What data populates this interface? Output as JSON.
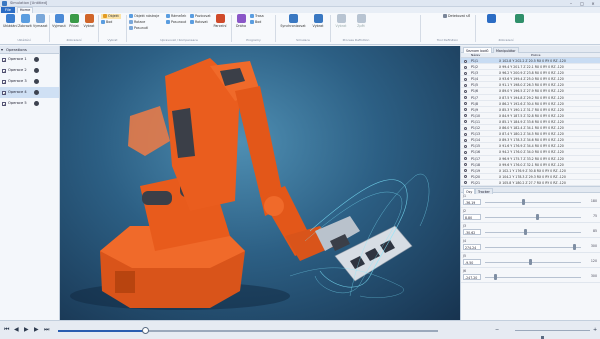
{
  "titlebar": {
    "title": "Simulation [Untitled]"
  },
  "tabs": {
    "file": "File",
    "home": "Home"
  },
  "ribbon": {
    "buttons": [
      {
        "label": "Ukládání"
      },
      {
        "label": "Zobrazit"
      },
      {
        "label": "Vymazat"
      },
      {
        "label": "Vyjmout"
      },
      {
        "label": "Přidat"
      },
      {
        "label": "Vybrat"
      },
      {
        "label": "Parcelní"
      },
      {
        "label": "Dráha"
      },
      {
        "label": "Synchronizovat"
      },
      {
        "label": "Vybrat"
      },
      {
        "label": "Vybrat"
      },
      {
        "label": "Zpět"
      }
    ],
    "small": [
      {
        "label": "Objekt"
      },
      {
        "label": "Bod"
      },
      {
        "label": "Objekt nástroje"
      },
      {
        "label": "Rotace"
      },
      {
        "label": "Posunutí"
      },
      {
        "label": "Rámeček"
      },
      {
        "label": "Posunout"
      },
      {
        "label": "Pozicovat"
      },
      {
        "label": "Rotovat"
      },
      {
        "label": "Trasa"
      },
      {
        "label": "Bod"
      },
      {
        "label": "Detekovat síť"
      }
    ],
    "groups": [
      "Ukládání",
      "Zobrazení",
      "Vybrat",
      "Upravovat / Kompensace",
      "Programy",
      "Simulace",
      "Process Definition",
      "Tool Definition",
      "Zobrazení"
    ]
  },
  "sidebar": {
    "header": "Operations",
    "items": [
      {
        "label": "Operace 1",
        "checked": true,
        "selected": false
      },
      {
        "label": "Operace 2",
        "checked": true,
        "selected": false
      },
      {
        "label": "Operace 3",
        "checked": true,
        "selected": false
      },
      {
        "label": "Operace 4",
        "checked": true,
        "selected": true
      },
      {
        "label": "Operace 5",
        "checked": true,
        "selected": false
      }
    ]
  },
  "right_panel": {
    "tabs": [
      "Seznam bodů",
      "Manipulátor"
    ],
    "columns": [
      "Název",
      "Pozice"
    ],
    "points": [
      {
        "name": "P1/1",
        "value": "X 102.8 Y 202.2 Z 20.5 RX 0 RY 0 RZ -120",
        "selected": true
      },
      {
        "name": "P1/2",
        "value": "X 99.4 Y 201.7 Z 22.1 RX 0 RY 0 RZ -120",
        "selected": false
      },
      {
        "name": "P1/3",
        "value": "X 96.2 Y 200.9 Z 23.8 RX 0 RY 0 RZ -120",
        "selected": false
      },
      {
        "name": "P1/4",
        "value": "X 93.6 Y 199.4 Z 25.0 RX 0 RY 0 RZ -120",
        "selected": false
      },
      {
        "name": "P1/5",
        "value": "X 91.1 Y 198.0 Z 26.3 RX 0 RY 0 RZ -120",
        "selected": false
      },
      {
        "name": "P1/6",
        "value": "X 89.0 Y 196.5 Z 27.9 RX 0 RY 0 RZ -120",
        "selected": false
      },
      {
        "name": "P1/7",
        "value": "X 87.5 Y 194.8 Z 29.2 RX 0 RY 0 RZ -120",
        "selected": false
      },
      {
        "name": "P1/8",
        "value": "X 86.2 Y 192.6 Z 30.4 RX 0 RY 0 RZ -120",
        "selected": false
      },
      {
        "name": "P1/9",
        "value": "X 85.3 Y 190.1 Z 31.7 RX 0 RY 0 RZ -120",
        "selected": false
      },
      {
        "name": "P1/10",
        "value": "X 84.9 Y 187.5 Z 32.8 RX 0 RY 0 RZ -120",
        "selected": false
      },
      {
        "name": "P1/11",
        "value": "X 85.1 Y 184.9 Z 33.6 RX 0 RY 0 RZ -120",
        "selected": false
      },
      {
        "name": "P1/12",
        "value": "X 86.0 Y 182.4 Z 34.1 RX 0 RY 0 RZ -120",
        "selected": false
      },
      {
        "name": "P1/13",
        "value": "X 87.4 Y 180.2 Z 34.5 RX 0 RY 0 RZ -120",
        "selected": false
      },
      {
        "name": "P1/14",
        "value": "X 89.3 Y 178.3 Z 34.6 RX 0 RY 0 RZ -120",
        "selected": false
      },
      {
        "name": "P1/15",
        "value": "X 91.6 Y 176.9 Z 34.4 RX 0 RY 0 RZ -120",
        "selected": false
      },
      {
        "name": "P1/16",
        "value": "X 94.2 Y 176.0 Z 34.0 RX 0 RY 0 RZ -120",
        "selected": false
      },
      {
        "name": "P1/17",
        "value": "X 96.9 Y 175.7 Z 33.2 RX 0 RY 0 RZ -120",
        "selected": false
      },
      {
        "name": "P1/18",
        "value": "X 99.6 Y 176.0 Z 32.1 RX 0 RY 0 RZ -120",
        "selected": false
      },
      {
        "name": "P1/19",
        "value": "X 102.1 Y 176.9 Z 30.8 RX 0 RY 0 RZ -120",
        "selected": false
      },
      {
        "name": "P1/20",
        "value": "X 104.2 Y 178.3 Z 29.3 RX 0 RY 0 RZ -120",
        "selected": false
      },
      {
        "name": "P1/21",
        "value": "X 105.8 Y 180.2 Z 27.7 RX 0 RY 0 RZ -120",
        "selected": false
      }
    ]
  },
  "joint_panel": {
    "tabs": [
      "Osy",
      "Tracker"
    ],
    "joints": [
      {
        "name": "J1",
        "value": "-36.19",
        "max": "180",
        "pos": 0.4
      },
      {
        "name": "J2",
        "value": "8.80",
        "max": "75",
        "pos": 0.55
      },
      {
        "name": "J3",
        "value": "-30.62",
        "max": "85",
        "pos": 0.42
      },
      {
        "name": "J4",
        "value": "274.24",
        "max": "300",
        "pos": 0.95
      },
      {
        "name": "J5",
        "value": "-9.50",
        "max": "120",
        "pos": 0.47
      },
      {
        "name": "J6",
        "value": "-247.20",
        "max": "300",
        "pos": 0.1
      }
    ]
  },
  "timeline": {
    "progress": 0.23,
    "zoom": 0.35
  },
  "colors": {
    "robot_orange": "#e8571c",
    "accent": "#2b6cc4"
  }
}
